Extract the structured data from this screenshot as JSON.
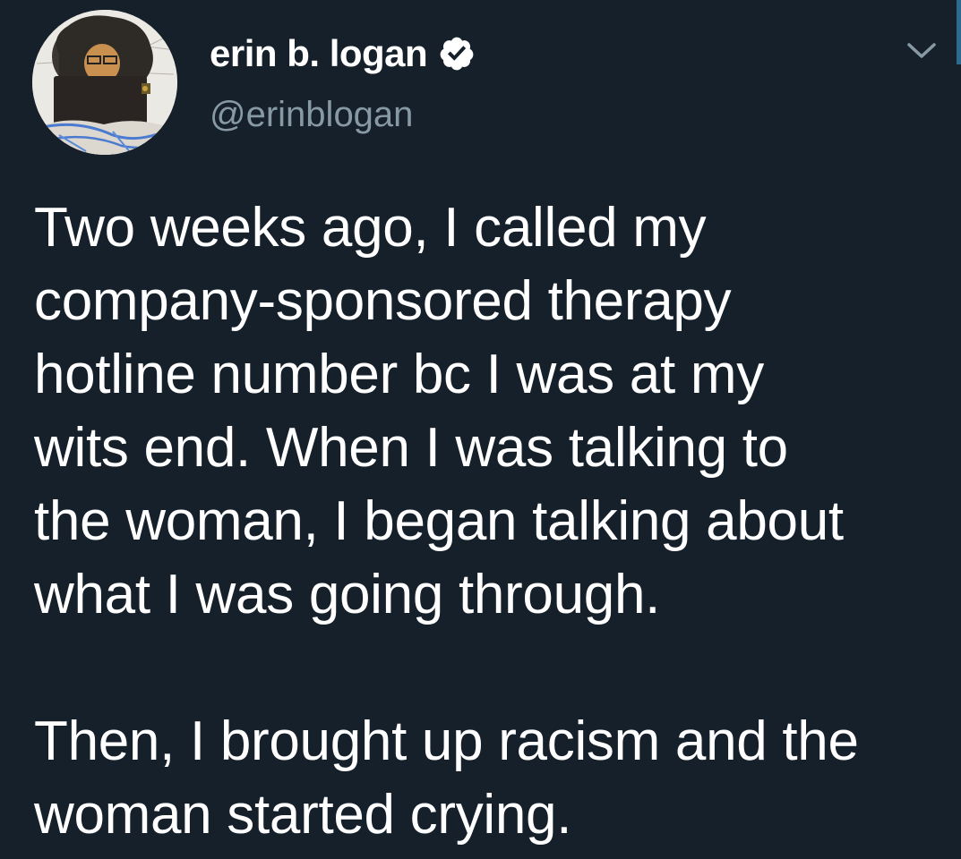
{
  "author": {
    "display_name": "erin b. logan",
    "handle": "@erinblogan",
    "verified": true
  },
  "icons": {
    "verified": "verified-badge-icon",
    "more": "chevron-down-icon"
  },
  "tweet": {
    "paragraph1_lines": [
      "Two weeks ago, I called my",
      "company-sponsored therapy",
      "hotline number bc I was at my",
      "wits end. When I was talking to",
      "the woman, I began talking about",
      "what I was going through."
    ],
    "paragraph2_lines": [
      "Then, I brought up racism and the",
      "woman started crying."
    ]
  },
  "colors": {
    "background": "#15202b",
    "text": "#ffffff",
    "secondary_text": "#8899a6"
  }
}
